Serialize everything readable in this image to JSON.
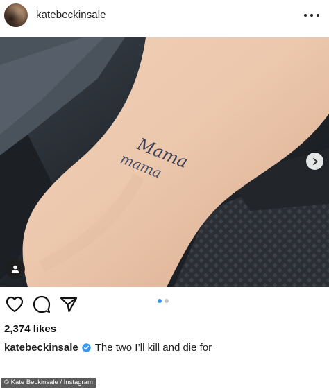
{
  "post": {
    "username": "katebeckinsale",
    "tattoo_line_1": "Mama",
    "tattoo_line_2": "mama",
    "likes": "2,374 likes",
    "caption_user": "katebeckinsale",
    "caption_text": "The two I’ll kill and die for",
    "carousel": {
      "total": 2,
      "current": 1
    }
  },
  "icons": {
    "more": "more-options-icon",
    "next": "chevron-right-icon",
    "tags": "user-tag-icon",
    "like": "heart-icon",
    "comment": "comment-icon",
    "share": "share-icon",
    "verified": "verified-badge-icon"
  },
  "colors": {
    "accent": "#3897f0",
    "dot_inactive": "#c4c4c4",
    "verified": "#3897f0"
  },
  "credit": {
    "text": "© Kate Beckinsale / Instagram"
  }
}
